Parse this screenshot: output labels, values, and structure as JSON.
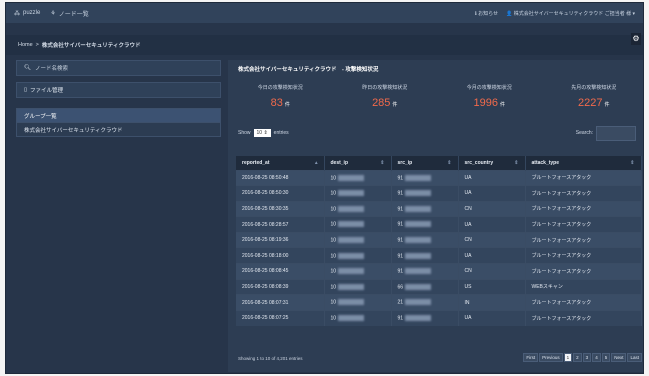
{
  "topbar": {
    "brand": "puzzle",
    "node_list": "ノード一覧",
    "notice": "お知らせ",
    "user": "株式会社サイバーセキュリティクラウド ご担当者 様"
  },
  "breadcrumb": {
    "home": "Home",
    "sep": ">",
    "current": "株式会社サイバーセキュリティクラウド"
  },
  "sidebar": {
    "search_placeholder": "ノード名検索",
    "file_mgmt": "ファイル管理",
    "group_head": "グループ一覧",
    "group_item": "株式会社サイバーセキュリティクラウド"
  },
  "main": {
    "title": "株式会社サイバーセキュリティクラウド　- 攻撃検知状況",
    "counters": [
      {
        "label": "今日の攻撃検知状況",
        "value": "83",
        "unit": "件"
      },
      {
        "label": "昨日の攻撃検知状況",
        "value": "285",
        "unit": "件"
      },
      {
        "label": "今月の攻撃検知状況",
        "value": "1996",
        "unit": "件"
      },
      {
        "label": "先月の攻撃検知状況",
        "value": "2227",
        "unit": "件"
      }
    ],
    "show": "Show",
    "entries_value": "10",
    "entries": "entries",
    "search_label": "Search:",
    "columns": [
      "reported_at",
      "dest_ip",
      "src_ip",
      "src_country",
      "attack_type"
    ],
    "rows": [
      [
        "2016-08-25 08:50:48",
        "10",
        "91",
        "UA",
        "ブルートフォースアタック"
      ],
      [
        "2016-08-25 08:50:30",
        "10",
        "91",
        "UA",
        "ブルートフォースアタック"
      ],
      [
        "2016-08-25 08:30:35",
        "10",
        "91",
        "CN",
        "ブルートフォースアタック"
      ],
      [
        "2016-08-25 08:28:57",
        "10",
        "91",
        "UA",
        "ブルートフォースアタック"
      ],
      [
        "2016-08-25 08:19:36",
        "10",
        "91",
        "CN",
        "ブルートフォースアタック"
      ],
      [
        "2016-08-25 08:18:00",
        "10",
        "91",
        "UA",
        "ブルートフォースアタック"
      ],
      [
        "2016-08-25 08:08:45",
        "10",
        "91",
        "CN",
        "ブルートフォースアタック"
      ],
      [
        "2016-08-25 08:08:39",
        "10",
        "66",
        "US",
        "WEBスキャン"
      ],
      [
        "2016-08-25 08:07:31",
        "10",
        "21",
        "IN",
        "ブルートフォースアタック"
      ],
      [
        "2016-08-25 08:07:25",
        "10",
        "91",
        "UA",
        "ブルートフォースアタック"
      ]
    ],
    "info": "Showing 1 to 10 of 4,201 entries",
    "pager": [
      "First",
      "Previous",
      "1",
      "2",
      "3",
      "4",
      "5",
      "Next",
      "Last"
    ],
    "active_page": "1"
  },
  "colors": {
    "accent": "#f26a4b",
    "bg": "#27354a",
    "panel": "#2d3d53"
  },
  "icons": {
    "brand": "puzzle-logo-icon",
    "nodes": "sitemap-icon",
    "info": "info-icon",
    "user": "user-icon",
    "settings": "gear-icon",
    "search": "search-icon",
    "file": "file-icon"
  }
}
